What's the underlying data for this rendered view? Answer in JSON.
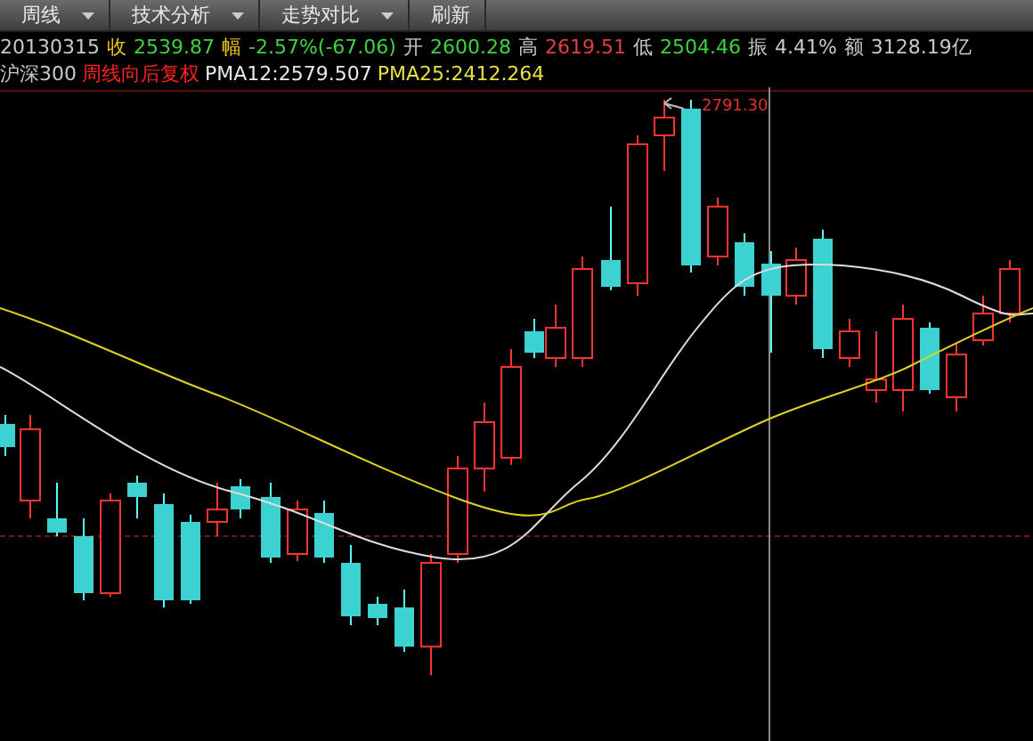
{
  "toolbar": [
    {
      "label": "周线",
      "kind": "dropdown"
    },
    {
      "label": "技术分析",
      "kind": "dropdown"
    },
    {
      "label": "走势对比",
      "kind": "dropdown"
    },
    {
      "label": "刷新",
      "kind": "button"
    }
  ],
  "quote": {
    "date": "20130315",
    "fields": [
      {
        "label": "收",
        "value": "2539.87",
        "color": "#3fd23f"
      },
      {
        "label": "幅",
        "value": "-2.57%(-67.06)",
        "color": "#3fd23f"
      },
      {
        "label": "开",
        "value": "2600.28",
        "color": "#3fd23f"
      },
      {
        "label": "高",
        "value": "2619.51",
        "color": "#e04040"
      },
      {
        "label": "低",
        "value": "2504.46",
        "color": "#3fd23f"
      },
      {
        "label": "振",
        "value": "4.41%",
        "color": "#c8c8c8"
      },
      {
        "label": "额",
        "value": "3128.19亿",
        "color": "#c8c8c8"
      }
    ]
  },
  "legend": [
    {
      "text": "沪深300",
      "color": "#c8c8c8"
    },
    {
      "text": "周线向后复权",
      "color": "#ff2020"
    },
    {
      "text": "PMA12:2579.507",
      "color": "#e8e8e8"
    },
    {
      "text": "PMA25:2412.264",
      "color": "#e8e040"
    }
  ],
  "chart": {
    "peak_label": "2791.30"
  }
}
